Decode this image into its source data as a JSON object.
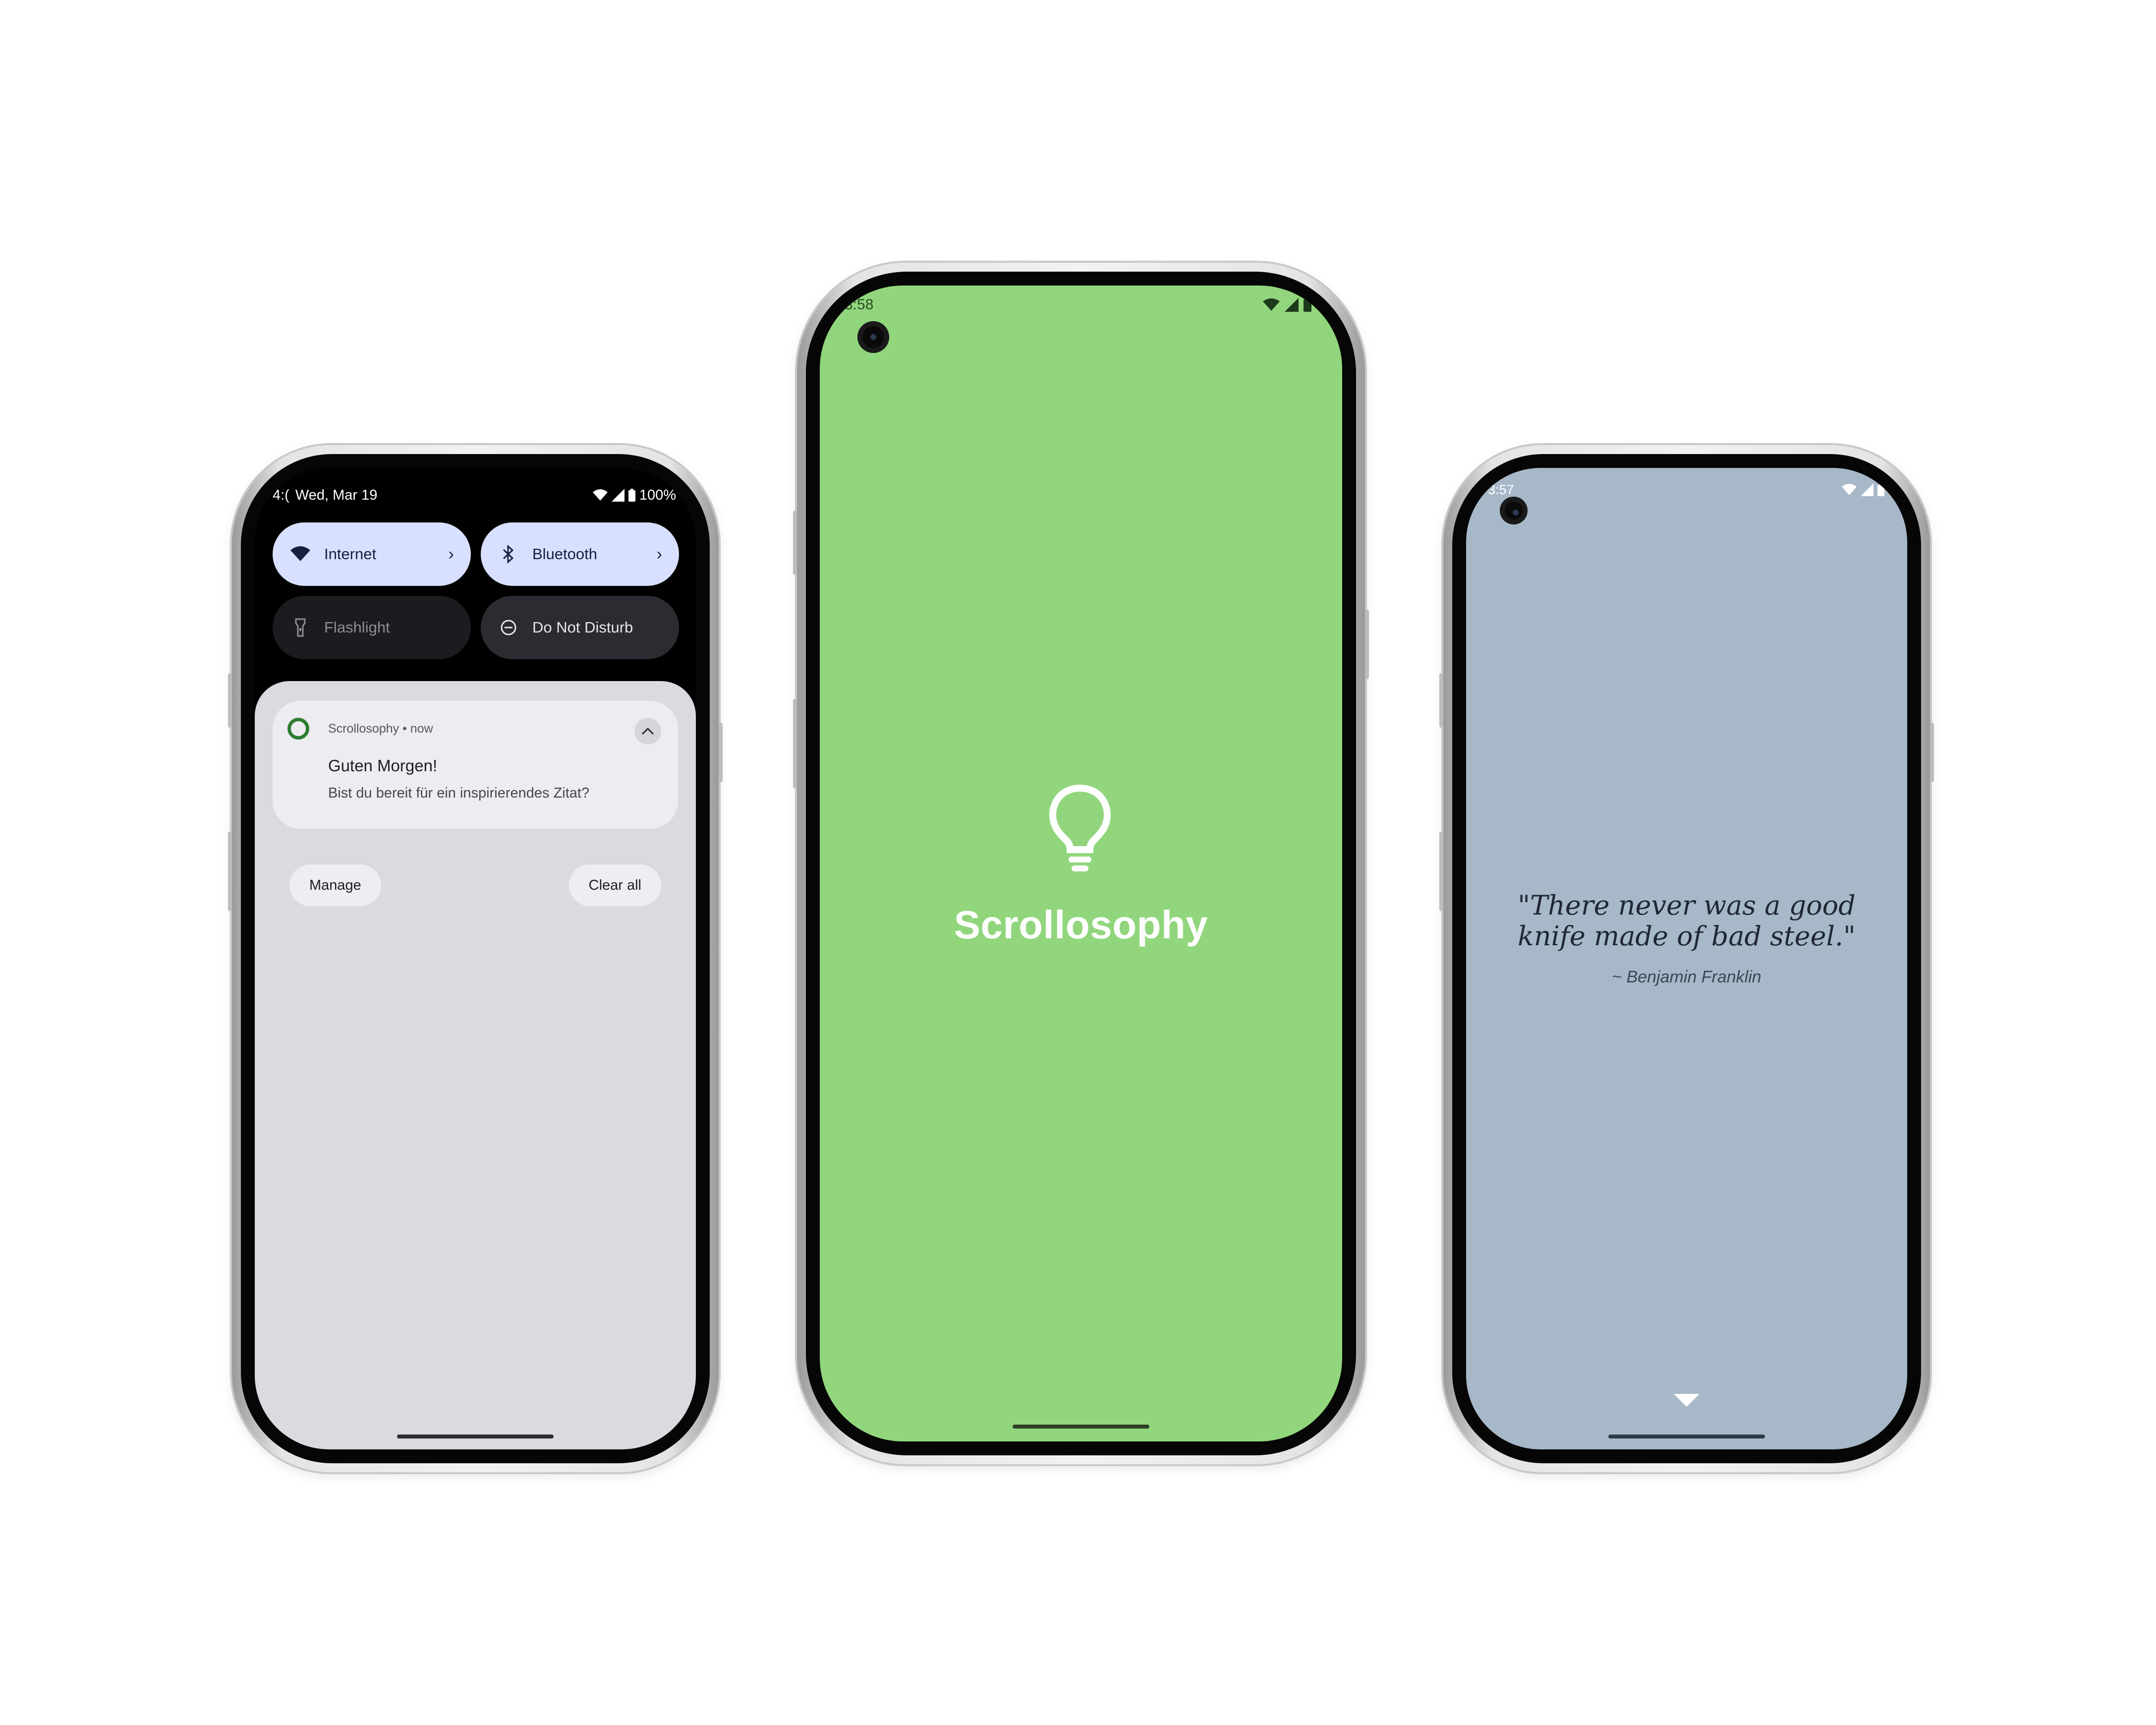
{
  "colors": {
    "splash_bg": "#91d67c",
    "quote_bg": "#a7b8c8",
    "tile_active": "#d9e0ff",
    "app_icon_ring": "#2e7d32",
    "shade_sheet": "#dadae0"
  },
  "phone_notification": {
    "status_bar": {
      "time": "4:(",
      "date": "Wed, Mar 19",
      "battery": "100%",
      "icons": [
        "wifi-icon",
        "signal-icon",
        "battery-icon"
      ]
    },
    "quick_tiles": [
      {
        "label": "Internet",
        "icon": "wifi-icon",
        "state": "on",
        "has_chevron": true
      },
      {
        "label": "Bluetooth",
        "icon": "bluetooth-icon",
        "state": "on",
        "has_chevron": true
      },
      {
        "label": "Flashlight",
        "icon": "flashlight-icon",
        "state": "off"
      },
      {
        "label": "Do Not Disturb",
        "icon": "do-not-disturb-icon",
        "state": "off"
      }
    ],
    "notification": {
      "app_name": "Scrollosophy",
      "separator": " • ",
      "time": "now",
      "title": "Guten Morgen!",
      "body": "Bist du bereit für ein inspirierendes Zitat?",
      "icon": "app-ring-icon"
    },
    "actions": {
      "manage": "Manage",
      "clear_all": "Clear all"
    }
  },
  "phone_splash": {
    "status_bar": {
      "time": "3:58",
      "icons": [
        "wifi-icon",
        "signal-icon",
        "battery-icon"
      ]
    },
    "logo_icon": "lightbulb-icon",
    "app_name": "Scrollosophy"
  },
  "phone_quote": {
    "status_bar": {
      "time": "3:57",
      "icons": [
        "wifi-icon",
        "signal-icon",
        "battery-icon"
      ]
    },
    "quote": "\"There never was a good knife made of bad steel.\"",
    "author": "~ Benjamin Franklin",
    "next_icon": "caret-down-icon"
  }
}
